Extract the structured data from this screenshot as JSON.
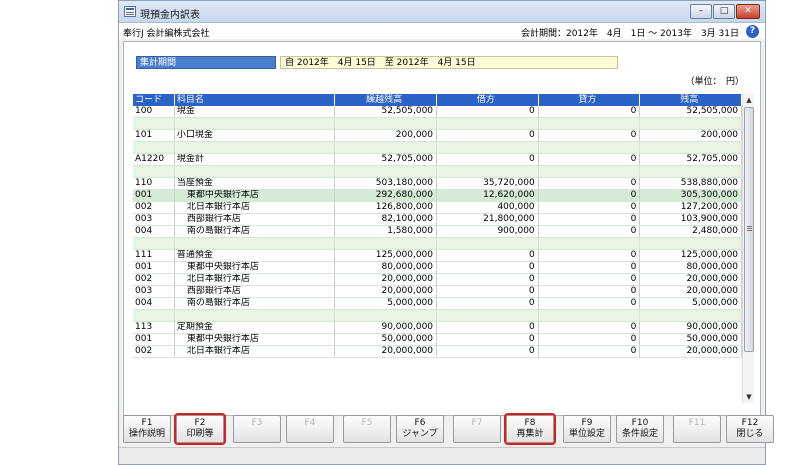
{
  "window": {
    "title": "現預金内訳表",
    "min_glyph": "–",
    "max_glyph": "□",
    "close_glyph": "✕"
  },
  "info": {
    "company": "奉行J 会計編株式会社",
    "period": "会計期間：2012年　4月　1日 ～ 2013年　3月 31日",
    "help_glyph": "?"
  },
  "filter": {
    "label": "集計期間",
    "value": "自 2012年　4月 15日　至 2012年　4月 15日"
  },
  "unit_text": "（単位：　円）",
  "grid": {
    "headers": [
      "コード",
      "科目名",
      "繰越残高",
      "借方",
      "貸方",
      "残高"
    ],
    "rows": [
      {
        "code": "100",
        "name": "現金",
        "carry": "52,505,000",
        "debit": "0",
        "credit": "0",
        "balance": "52,505,000"
      },
      {
        "code": "",
        "name": "",
        "carry": "",
        "debit": "",
        "credit": "",
        "balance": ""
      },
      {
        "code": "101",
        "name": "小口現金",
        "carry": "200,000",
        "debit": "0",
        "credit": "0",
        "balance": "200,000"
      },
      {
        "code": "",
        "name": "",
        "carry": "",
        "debit": "",
        "credit": "",
        "balance": ""
      },
      {
        "code": "A1220",
        "name": "現金計",
        "carry": "52,705,000",
        "debit": "0",
        "credit": "0",
        "balance": "52,705,000"
      },
      {
        "code": "",
        "name": "",
        "carry": "",
        "debit": "",
        "credit": "",
        "balance": ""
      },
      {
        "code": "110",
        "name": "当座預金",
        "carry": "503,180,000",
        "debit": "35,720,000",
        "credit": "0",
        "balance": "538,880,000"
      },
      {
        "code": "001",
        "name": "東都中央銀行本店",
        "carry": "292,680,000",
        "debit": "12,620,000",
        "credit": "0",
        "balance": "305,300,000"
      },
      {
        "code": "002",
        "name": "北日本銀行本店",
        "carry": "126,800,000",
        "debit": "400,000",
        "credit": "0",
        "balance": "127,200,000"
      },
      {
        "code": "003",
        "name": "西部銀行本店",
        "carry": "82,100,000",
        "debit": "21,800,000",
        "credit": "0",
        "balance": "103,900,000"
      },
      {
        "code": "004",
        "name": "南の島銀行本店",
        "carry": "1,580,000",
        "debit": "900,000",
        "credit": "0",
        "balance": "2,480,000"
      },
      {
        "code": "",
        "name": "",
        "carry": "",
        "debit": "",
        "credit": "",
        "balance": ""
      },
      {
        "code": "111",
        "name": "普通預金",
        "carry": "125,000,000",
        "debit": "0",
        "credit": "0",
        "balance": "125,000,000"
      },
      {
        "code": "001",
        "name": "東都中央銀行本店",
        "carry": "80,000,000",
        "debit": "0",
        "credit": "0",
        "balance": "80,000,000"
      },
      {
        "code": "002",
        "name": "北日本銀行本店",
        "carry": "20,000,000",
        "debit": "0",
        "credit": "0",
        "balance": "20,000,000"
      },
      {
        "code": "003",
        "name": "西部銀行本店",
        "carry": "20,000,000",
        "debit": "0",
        "credit": "0",
        "balance": "20,000,000"
      },
      {
        "code": "004",
        "name": "南の島銀行本店",
        "carry": "5,000,000",
        "debit": "0",
        "credit": "0",
        "balance": "5,000,000"
      },
      {
        "code": "",
        "name": "",
        "carry": "",
        "debit": "",
        "credit": "",
        "balance": ""
      },
      {
        "code": "113",
        "name": "定期預金",
        "carry": "90,000,000",
        "debit": "0",
        "credit": "0",
        "balance": "90,000,000"
      },
      {
        "code": "001",
        "name": "東都中央銀行本店",
        "carry": "50,000,000",
        "debit": "0",
        "credit": "0",
        "balance": "50,000,000"
      },
      {
        "code": "002",
        "name": "北日本銀行本店",
        "carry": "20,000,000",
        "debit": "0",
        "credit": "0",
        "balance": "20,000,000"
      }
    ]
  },
  "scrollbar": {
    "up": "▲",
    "down": "▼"
  },
  "fkeys": [
    {
      "key": "F1",
      "label": "操作説明",
      "enabled": true,
      "highlighted": false
    },
    {
      "key": "F2",
      "label": "印刷等",
      "enabled": true,
      "highlighted": true
    },
    {
      "key": "F3",
      "label": "",
      "enabled": false,
      "highlighted": false
    },
    {
      "key": "F4",
      "label": "",
      "enabled": false,
      "highlighted": false
    },
    {
      "key": "F5",
      "label": "",
      "enabled": false,
      "highlighted": false
    },
    {
      "key": "F6",
      "label": "ジャンプ",
      "enabled": true,
      "highlighted": false
    },
    {
      "key": "F7",
      "label": "",
      "enabled": false,
      "highlighted": false
    },
    {
      "key": "F8",
      "label": "再集計",
      "enabled": true,
      "highlighted": true
    },
    {
      "key": "F9",
      "label": "単位設定",
      "enabled": true,
      "highlighted": false
    },
    {
      "key": "F10",
      "label": "条件設定",
      "enabled": true,
      "highlighted": false
    },
    {
      "key": "F11",
      "label": "",
      "enabled": false,
      "highlighted": false
    },
    {
      "key": "F12",
      "label": "閉じる",
      "enabled": true,
      "highlighted": false
    }
  ],
  "colors": {
    "header_blue": "#2a62c6",
    "blank_row_green": "#e8f5e4",
    "selected_row": "#d5ebd5",
    "highlight_red": "#d42020",
    "filter_value_bg": "#fffbd6"
  }
}
